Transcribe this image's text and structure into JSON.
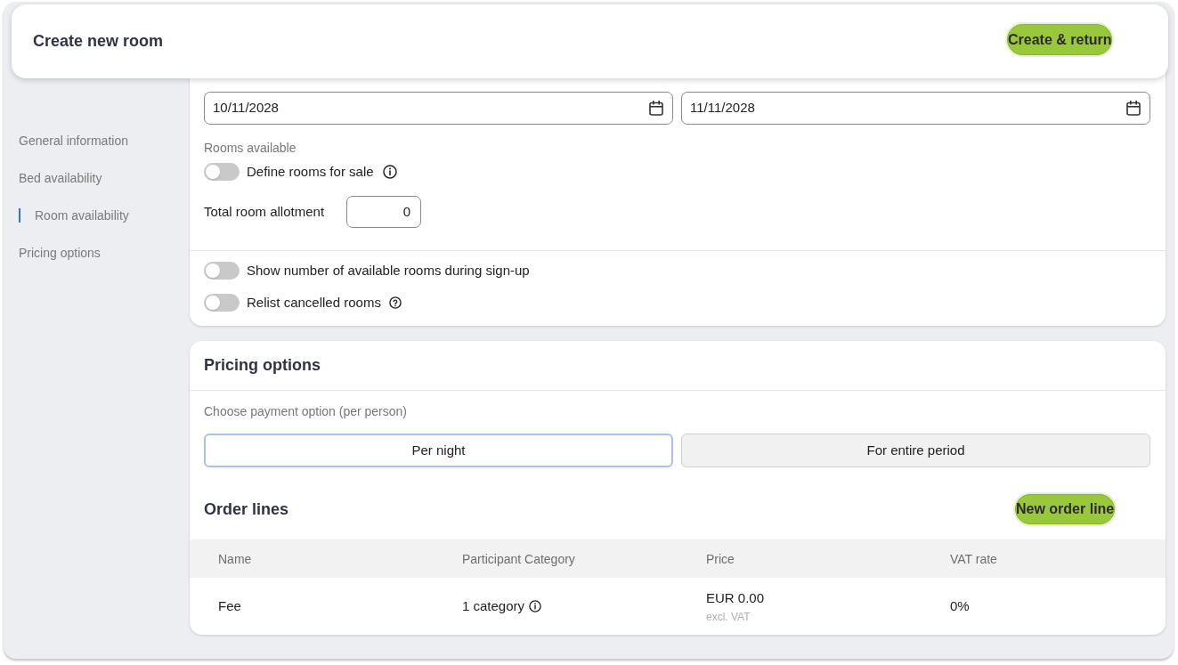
{
  "header": {
    "title": "Create new room",
    "action": "Create & return"
  },
  "sidebar": {
    "items": [
      {
        "label": "General information",
        "selected": false
      },
      {
        "label": "Bed availability",
        "selected": false
      },
      {
        "label": "Room availability",
        "selected": true
      },
      {
        "label": "Pricing options",
        "selected": false
      }
    ]
  },
  "room_availability": {
    "dates": [
      {
        "value": "10/11/2028"
      },
      {
        "value": "11/11/2028"
      }
    ],
    "rooms_available_label": "Rooms available",
    "define_rooms": {
      "label": "Define rooms for sale",
      "on": false
    },
    "allotment": {
      "label": "Total room allotment",
      "value": "0"
    },
    "options": [
      {
        "kind": "plain",
        "label": "Show number of available rooms during sign-up",
        "on": false
      },
      {
        "kind": "hint",
        "label": "Relist cancelled rooms",
        "on": false
      }
    ]
  },
  "pricing": {
    "title": "Pricing options",
    "payment_label": "Choose payment option (per person)",
    "payment_options": [
      {
        "label": "Per night",
        "selected": true
      },
      {
        "label": "For entire period",
        "selected": false
      }
    ],
    "order_lines": {
      "title": "Order lines",
      "action": "New order line",
      "columns": [
        "Name",
        "Participant Category",
        "Price",
        "VAT rate"
      ],
      "rows": [
        {
          "name": "Fee",
          "category": "1 category",
          "price": "EUR 0.00",
          "price_note": "excl. VAT",
          "vat_rate": "0%"
        }
      ]
    }
  }
}
